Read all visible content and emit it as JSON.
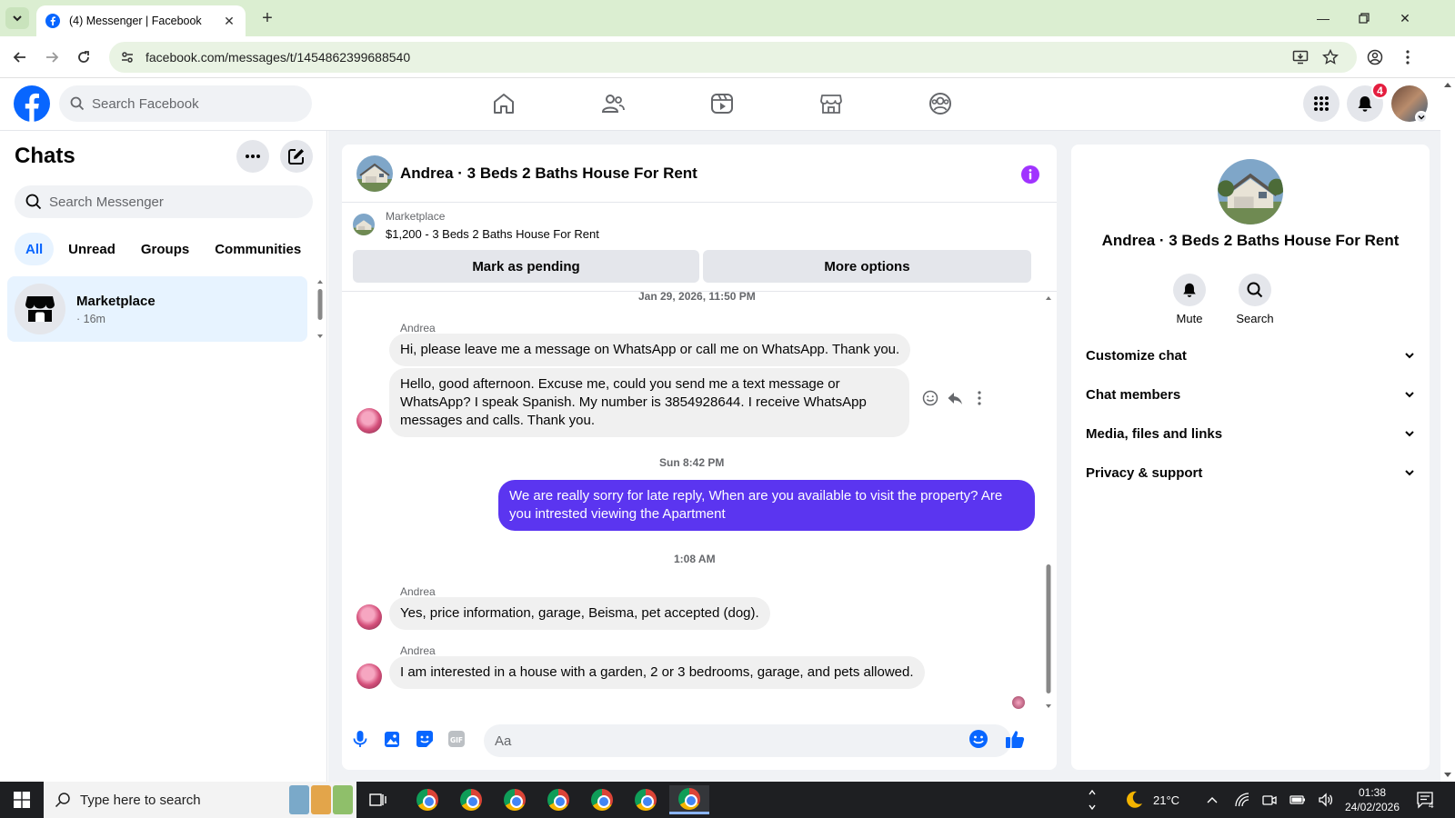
{
  "browser": {
    "tab_title": "(4) Messenger | Facebook",
    "url": "facebook.com/messages/t/1454862399688540"
  },
  "fb": {
    "search_placeholder": "Search Facebook",
    "notification_count": "4",
    "brand_color": "#0866ff"
  },
  "left": {
    "title": "Chats",
    "search_placeholder": "Search Messenger",
    "filters": [
      "All",
      "Unread",
      "Groups",
      "Communities"
    ],
    "chat": {
      "name": "Marketplace",
      "time": "· 16m"
    }
  },
  "conversation": {
    "title": "Andrea · 3 Beds 2 Baths House For Rent",
    "marketplace_label": "Marketplace",
    "listing": "$1,200 - 3 Beds 2 Baths House For Rent",
    "mark_pending": "Mark as pending",
    "more_options": "More options",
    "ts1": "Jan 29, 2026, 11:50 PM",
    "sender": "Andrea",
    "m1": "Hi, please leave me a message on WhatsApp or call me on WhatsApp. Thank you.",
    "m2": "Hello, good afternoon. Excuse me, could you send me a text message or WhatsApp? I speak Spanish. My number is 3854928644. I receive WhatsApp messages and calls. Thank you.",
    "ts2": "Sun 8:42 PM",
    "m3": "We are really sorry for late reply, When are you available to visit the property? Are you intrested viewing the Apartment",
    "ts3": "1:08 AM",
    "m4": "Yes, price information, garage, Beisma, pet accepted (dog).",
    "m5": "I am interested in a house with a garden, 2 or 3 bedrooms, garage, and pets allowed.",
    "composer_placeholder": "Aa",
    "outgoing_color": "#5b35f0"
  },
  "right": {
    "name": "Andrea · 3 Beds 2 Baths House For Rent",
    "mute": "Mute",
    "search": "Search",
    "rows": [
      "Customize chat",
      "Chat members",
      "Media, files and links",
      "Privacy & support"
    ]
  },
  "taskbar": {
    "search_placeholder": "Type here to search",
    "temp": "21°C",
    "time": "01:38",
    "date": "24/02/2026",
    "notif": "4"
  }
}
